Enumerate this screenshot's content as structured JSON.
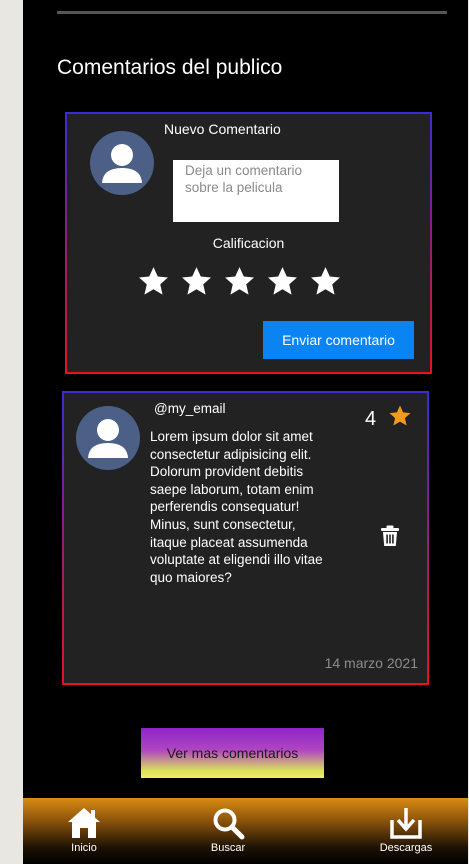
{
  "section": {
    "title": "Comentarios del publico"
  },
  "new_comment": {
    "heading": "Nuevo Comentario",
    "placeholder": "Deja un comentario sobre la pelicula",
    "rating_label": "Calificacion",
    "stars": 5,
    "submit_label": "Enviar comentario"
  },
  "comment": {
    "email": "@my_email",
    "rating": "4",
    "text": "Lorem ipsum dolor sit amet consectetur adipisicing elit. Dolorum provident debitis saepe laborum, totam enim perferendis consequatur! Minus, sunt consectetur, itaque placeat assumenda voluptate at eligendi illo vitae quo maiores?",
    "date": "14 marzo 2021"
  },
  "more_button": {
    "label": "Ver mas comentarios"
  },
  "nav": {
    "inicio": "Inicio",
    "buscar": "Buscar",
    "descargas": "Descargas"
  },
  "colors": {
    "accent_blue": "#0b84f3",
    "star_rating": "#f29b1d",
    "card_bg": "#222222"
  },
  "icons": [
    "user-avatar-icon",
    "star-icon",
    "trash-icon",
    "home-icon",
    "search-icon",
    "download-icon"
  ]
}
